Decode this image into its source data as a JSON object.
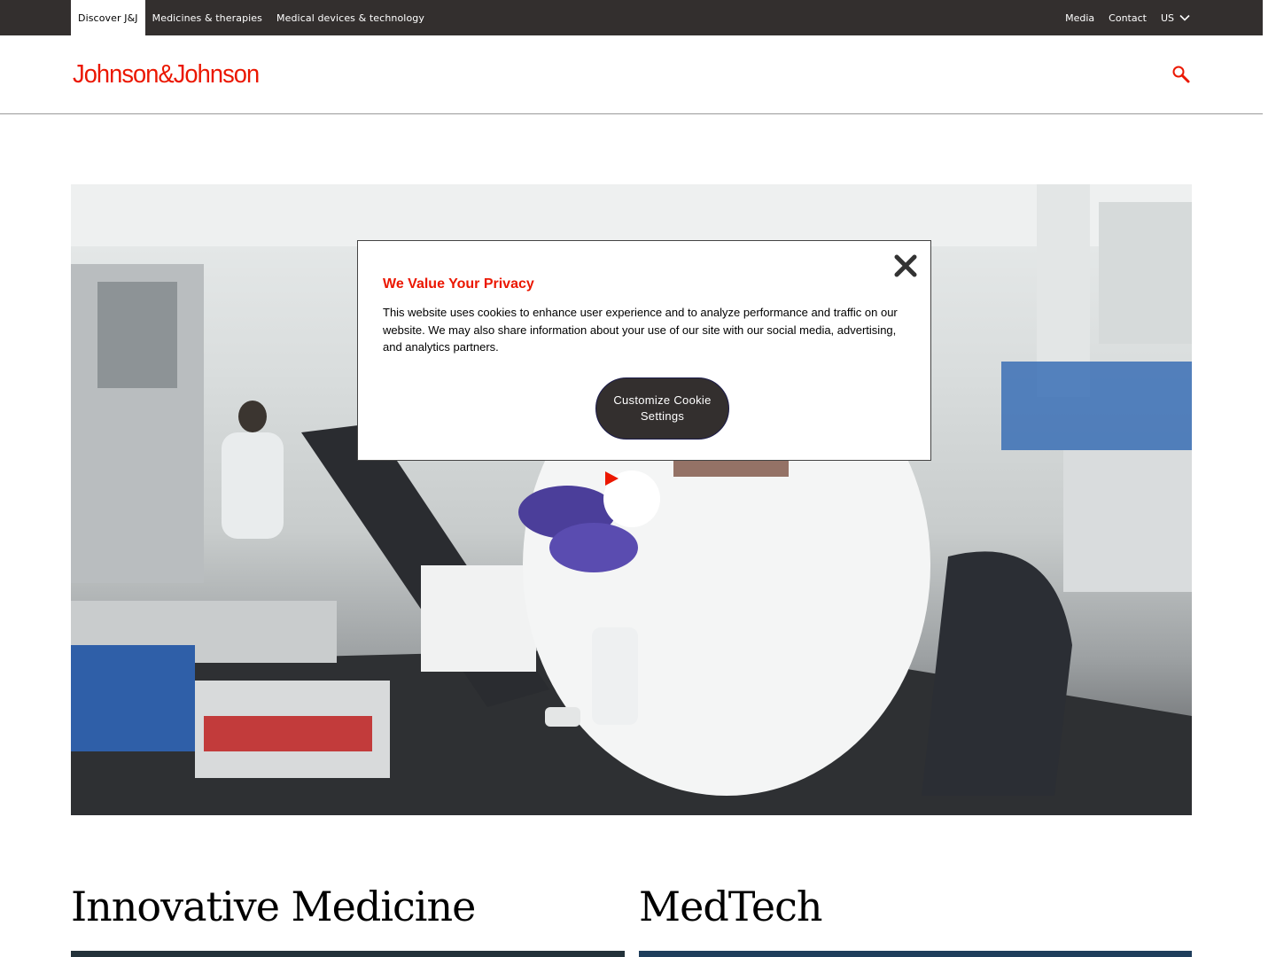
{
  "utility_nav": {
    "tabs": [
      {
        "label": "Discover J&J",
        "active": true
      },
      {
        "label": "Medicines & therapies",
        "active": false
      },
      {
        "label": "Medical devices & technology",
        "active": false
      }
    ],
    "links": {
      "media": "Media",
      "contact": "Contact",
      "region": "US"
    }
  },
  "header": {
    "logo_text": "Johnson&Johnson",
    "search_icon": "search-icon"
  },
  "hero": {
    "play_icon": "play-icon"
  },
  "cookie_dialog": {
    "title": "We Value Your Privacy",
    "body": "This website uses cookies to enhance user experience and to analyze performance and traffic on our website. We may also share information about your use of our site with our social media, advertising, and analytics partners.",
    "button_label": "Customize Cookie Settings",
    "close_icon": "close-icon"
  },
  "sections": [
    {
      "title": "Innovative Medicine"
    },
    {
      "title": "MedTech"
    }
  ],
  "colors": {
    "brand_red": "#eb1700",
    "dark_bar": "#332f2e"
  }
}
